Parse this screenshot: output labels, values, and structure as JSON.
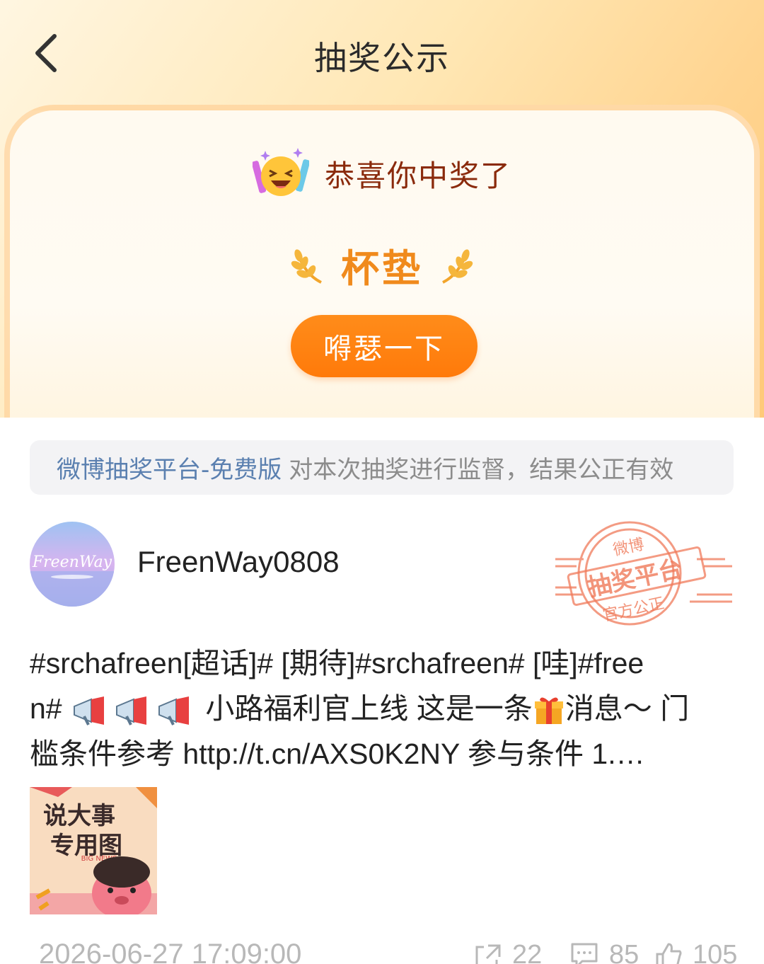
{
  "nav": {
    "title": "抽奖公示",
    "back_icon": "chevron-left-icon"
  },
  "prize": {
    "congrats": "恭喜你中奖了",
    "congrats_icon": "laughing-party-emoji-icon",
    "name": "杯垫",
    "laurel_icon": "wheat-laurel-icon",
    "show_button": "嘚瑟一下",
    "accent_color": "#ff7d0f"
  },
  "notice": {
    "link": "微博抽奖平台-免费版",
    "text": "对本次抽奖进行监督，结果公正有效"
  },
  "post": {
    "username": "FreenWay0808",
    "avatar_text": "FreenWay",
    "stamp": {
      "top": "微博",
      "main": "抽奖平台",
      "bottom": "官方公正"
    },
    "line1": "#srchafreen[超话]# [期待]#srchafreen# [哇]#free",
    "line2a": "n#",
    "line2b": "小路福利官上线 这是一条",
    "line2c": "消息～ 门",
    "line3": "槛条件参考 http://t.cn/AXS0K2NY 参与条件 1.…",
    "image": {
      "title1": "说大事",
      "title2": "专用图",
      "caption": "BIG NEWS"
    },
    "time": "2026-06-27 17:09:00",
    "shares": "22",
    "comments": "85",
    "likes": "105"
  }
}
